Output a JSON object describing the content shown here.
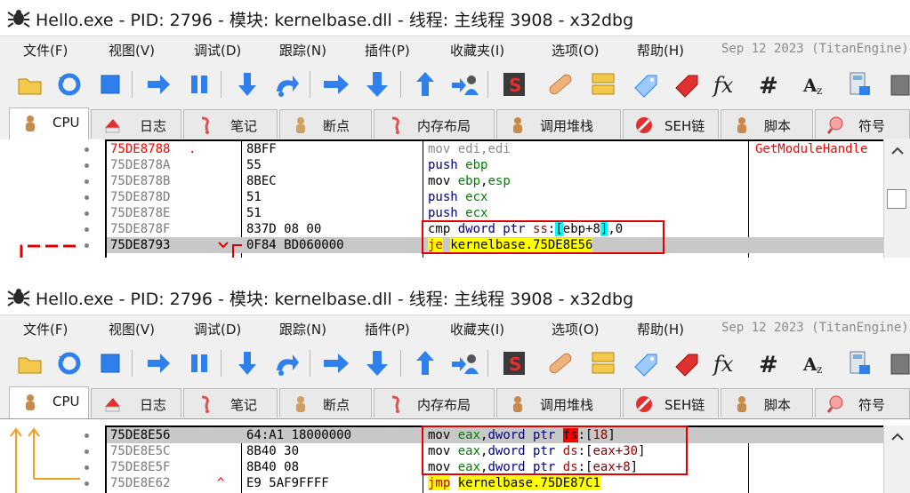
{
  "window": {
    "title": "Hello.exe - PID: 2796 - 模块: kernelbase.dll - 线程: 主线程 3908 - x32dbg"
  },
  "menu": {
    "items": [
      "文件(F)",
      "视图(V)",
      "调试(D)",
      "跟踪(N)",
      "插件(P)",
      "收藏夹(I)",
      "选项(O)",
      "帮助(H)"
    ],
    "build_date": "Sep 12 2023 (TitanEngine)"
  },
  "toolbar": {
    "icons": [
      "open-icon",
      "restart-icon",
      "stop-icon",
      "run-icon",
      "pause-icon",
      "step-into-icon",
      "step-over-icon",
      "trace-into-icon",
      "trace-over-icon",
      "execute-till-return-icon",
      "run-to-user-code-icon",
      "scylla-icon",
      "patch-icon",
      "comments-icon",
      "labels-icon",
      "bookmarks-icon",
      "functions-icon",
      "hash-icon",
      "font-icon",
      "calculator-icon"
    ]
  },
  "tabs": [
    {
      "label": "CPU",
      "icon": "cpu-icon"
    },
    {
      "label": "日志",
      "icon": "log-icon"
    },
    {
      "label": "笔记",
      "icon": "notes-icon"
    },
    {
      "label": "断点",
      "icon": "breakpoints-icon"
    },
    {
      "label": "内存布局",
      "icon": "memory-map-icon"
    },
    {
      "label": "调用堆栈",
      "icon": "call-stack-icon"
    },
    {
      "label": "SEH链",
      "icon": "seh-icon"
    },
    {
      "label": "脚本",
      "icon": "script-icon"
    },
    {
      "label": "符号",
      "icon": "symbols-icon"
    }
  ],
  "top_disasm": {
    "rows": [
      {
        "addr": "75DE8788",
        "bytes": "8BFF",
        "asm": "mov edi,edi",
        "comment": "GetModuleHandle"
      },
      {
        "addr": "75DE878A",
        "bytes": "55",
        "asm": "push ebp"
      },
      {
        "addr": "75DE878B",
        "bytes": "8BEC",
        "asm": "mov ebp,esp"
      },
      {
        "addr": "75DE878D",
        "bytes": "51",
        "asm": "push ecx"
      },
      {
        "addr": "75DE878E",
        "bytes": "51",
        "asm": "push ecx"
      },
      {
        "addr": "75DE878F",
        "bytes": "837D 08 00",
        "asm": "cmp dword ptr ss:[ebp+8],0"
      },
      {
        "addr": "75DE8793",
        "bytes": "0F84 BD060000",
        "asm": "je kernelbase.75DE8E56"
      }
    ],
    "asm_parts": {
      "mov1": "mov",
      "mov1_ops": "edi,edi",
      "push": "push",
      "ebp": "ebp",
      "mov3": "mov",
      "mov3_r1": "ebp",
      "mov3_r2": "esp",
      "ecx": "ecx",
      "cmp": "cmp",
      "dword_ptr": "dword ptr",
      "ss": "ss",
      "ebp_plus8": "ebp+8",
      "zero": "0",
      "je": "je",
      "je_target": "kernelbase.75DE8E56",
      "comma": ","
    }
  },
  "bottom_disasm": {
    "rows": [
      {
        "addr": "75DE8E56",
        "bytes": "64:A1 18000000",
        "asm": "mov eax,dword ptr fs:[18]"
      },
      {
        "addr": "75DE8E5C",
        "bytes": "8B40 30",
        "asm": "mov eax,dword ptr ds:[eax+30]"
      },
      {
        "addr": "75DE8E5F",
        "bytes": "8B40 08",
        "asm": "mov eax,dword ptr ds:[eax+8]"
      },
      {
        "addr": "75DE8E62",
        "bytes": "E9 5AF9FFFF",
        "asm": "jmp kernelbase.75DE87C1"
      }
    ],
    "asm_parts": {
      "mov": "mov",
      "eax": "eax",
      "dword_ptr": "dword ptr",
      "fs": "fs",
      "idx18": "18",
      "ds": "ds",
      "eax30": "eax+30",
      "eax8": "eax+8",
      "jmp": "jmp",
      "jmp_target": "kernelbase.75DE87C1"
    }
  },
  "colors": {
    "accent_red": "#e00000",
    "jump_yellow": "#ffff00",
    "register_green": "#008000",
    "selection_grey": "#c8c8c8"
  }
}
